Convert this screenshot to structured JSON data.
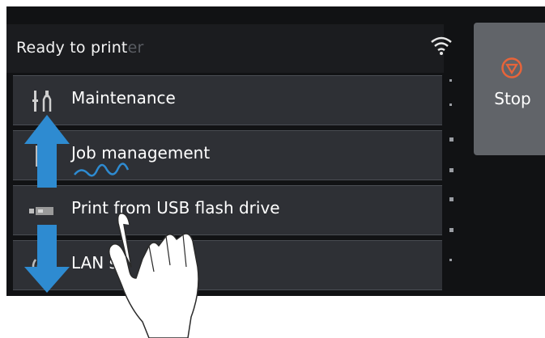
{
  "status": {
    "text": "Ready to print",
    "ghost_text": "Ready to printer"
  },
  "menu": {
    "items": [
      {
        "label": "Maintenance",
        "icon": "tools-icon"
      },
      {
        "label": "Job management",
        "icon": "job-list-icon"
      },
      {
        "label": "Print from USB flash drive",
        "icon": "usb-icon"
      },
      {
        "label": "LAN se",
        "icon": "lan-icon"
      }
    ]
  },
  "stop": {
    "label": "Stop",
    "icon": "stop-icon"
  },
  "colors": {
    "screen_bg": "#111214",
    "item_bg": "#2e3035",
    "stop_bg": "#616469",
    "stop_icon": "#e8643a",
    "arrow": "#2e8bd1"
  }
}
